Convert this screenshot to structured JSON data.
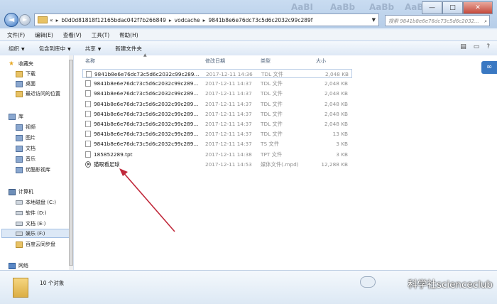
{
  "address": {
    "crumbs": [
      "b0d0d81818f12165bdac042f7b266849",
      "vodcache",
      "9841b8e6e76dc73c5d6c2032c99c289f"
    ],
    "root_chevron": "«"
  },
  "search": {
    "placeholder": "搜索 9841b8e6e76dc73c5d6c2032..."
  },
  "faded": [
    "AaBI",
    "AaBb",
    "AaBb",
    "AaBb"
  ],
  "window_buttons": {
    "minimize": "—",
    "maximize": "□",
    "close": "✕"
  },
  "menu": [
    "文件(F)",
    "编辑(E)",
    "查看(V)",
    "工具(T)",
    "帮助(H)"
  ],
  "toolbar": {
    "organize": "组织",
    "include": "包含到库中",
    "share": "共享",
    "new_folder": "新建文件夹"
  },
  "nav": {
    "favorites": "收藏夹",
    "downloads": "下载",
    "desktop": "桌面",
    "recent": "最近访问的位置",
    "libraries": "库",
    "videos": "视频",
    "pictures": "图片",
    "documents": "文档",
    "music": "音乐",
    "youku": "优酷影视库",
    "computer": "计算机",
    "drive_c": "本地磁盘 (C:)",
    "drive_d": "软件 (D:)",
    "drive_e": "文档 (E:)",
    "drive_f": "娱乐 (F:)",
    "baidu": "百度云同步盘",
    "network": "网络"
  },
  "columns": {
    "name": "名称",
    "date": "修改日期",
    "type": "类型",
    "size": "大小"
  },
  "files": [
    {
      "name": "9841b8e6e76dc73c5d6c2032c99c289...",
      "date": "2017-12-11 14:36",
      "type": "TDL 文件",
      "size": "2,048 KB",
      "icon": "file"
    },
    {
      "name": "9841b8e6e76dc73c5d6c2032c99c289...",
      "date": "2017-12-11 14:37",
      "type": "TDL 文件",
      "size": "2,048 KB",
      "icon": "file"
    },
    {
      "name": "9841b8e6e76dc73c5d6c2032c99c289...",
      "date": "2017-12-11 14:37",
      "type": "TDL 文件",
      "size": "2,048 KB",
      "icon": "file"
    },
    {
      "name": "9841b8e6e76dc73c5d6c2032c99c289...",
      "date": "2017-12-11 14:37",
      "type": "TDL 文件",
      "size": "2,048 KB",
      "icon": "file"
    },
    {
      "name": "9841b8e6e76dc73c5d6c2032c99c289...",
      "date": "2017-12-11 14:37",
      "type": "TDL 文件",
      "size": "2,048 KB",
      "icon": "file"
    },
    {
      "name": "9841b8e6e76dc73c5d6c2032c99c289...",
      "date": "2017-12-11 14:37",
      "type": "TDL 文件",
      "size": "2,048 KB",
      "icon": "file"
    },
    {
      "name": "9841b8e6e76dc73c5d6c2032c99c289...",
      "date": "2017-12-11 14:37",
      "type": "TDL 文件",
      "size": "13 KB",
      "icon": "file"
    },
    {
      "name": "9841b8e6e76dc73c5d6c2032c99c289...",
      "date": "2017-12-11 14:37",
      "type": "TS 文件",
      "size": "3 KB",
      "icon": "file"
    },
    {
      "name": "185852289.tpt",
      "date": "2017-12-11 14:38",
      "type": "TPT 文件",
      "size": "3 KB",
      "icon": "file"
    },
    {
      "name": "猫眼看足球",
      "date": "2017-12-11 14:53",
      "type": "媒体文件(.mpd)",
      "size": "12,288 KB",
      "icon": "media"
    }
  ],
  "status": {
    "count": "10 个对象"
  },
  "watermark": "科学社scienceclub"
}
